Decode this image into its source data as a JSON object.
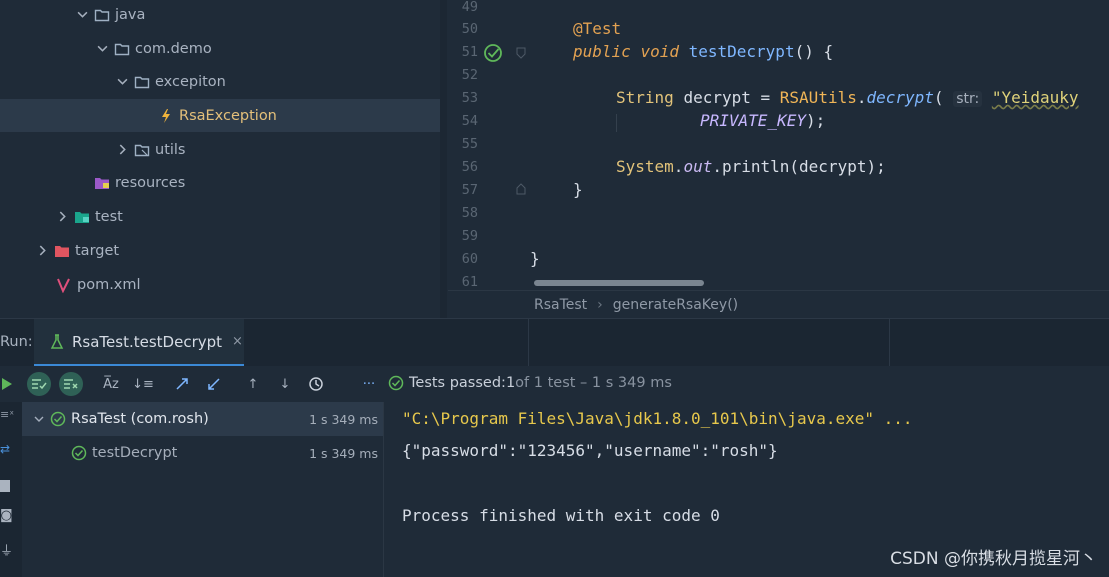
{
  "tree": [
    {
      "label": "java",
      "icon": "folder-icon",
      "expanded": true
    },
    {
      "label": "com.demo",
      "icon": "package-folder-icon",
      "expanded": true
    },
    {
      "label": "excepiton",
      "icon": "package-folder-icon",
      "expanded": true
    },
    {
      "label": "RsaException",
      "icon": "exception-class-icon"
    },
    {
      "label": "utils",
      "icon": "package-folder-icon",
      "expanded": false
    },
    {
      "label": "resources",
      "icon": "resources-folder-icon"
    },
    {
      "label": "test",
      "icon": "test-folder-icon",
      "expanded": false
    },
    {
      "label": "target",
      "icon": "excluded-folder-icon",
      "expanded": false
    },
    {
      "label": "pom.xml",
      "icon": "maven-icon"
    }
  ],
  "editor": {
    "line_numbers": [
      "49",
      "50",
      "51",
      "52",
      "53",
      "54",
      "55",
      "56",
      "57",
      "58",
      "59",
      "60",
      "61"
    ],
    "code": {
      "annotation": "@Test",
      "kw_public": "public",
      "kw_void": "void",
      "method_name": "testDecrypt",
      "sig_rest": "() {",
      "type_string": "String",
      "var_decrypt": "decrypt",
      "eq": " = ",
      "class_rsautils": "RSAUtils",
      "dot": ".",
      "method_decrypt": "decrypt",
      "paren_open": "(",
      "hint_str": "str:",
      "string_arg": "\"Yeidauky",
      "const_private_key": "PRIVATE_KEY",
      "close_stmt": ");",
      "system": "System",
      "out": "out",
      "println": ".println(decrypt);",
      "brace_close": "}",
      "class_close": "}"
    },
    "breadcrumb": [
      "RsaTest",
      "generateRsaKey()"
    ],
    "colors": {
      "keyword": "#e3a252",
      "method": "#7fb7ff",
      "string": "#e0d37a",
      "background": "#1f2b38"
    }
  },
  "run": {
    "label": "Run:",
    "tab_title": "RsaTest.testDecrypt",
    "tab_close": "×",
    "status": {
      "prefix": "Tests passed: ",
      "count": "1",
      "suffix": " of 1 test – 1 s 349 ms"
    },
    "test_tree": [
      {
        "label": "RsaTest (com.rosh)",
        "time": "1 s 349 ms"
      },
      {
        "label": "testDecrypt",
        "time": "1 s 349 ms"
      }
    ],
    "console": [
      "\"C:\\Program Files\\Java\\jdk1.8.0_101\\bin\\java.exe\" ...",
      "{\"password\":\"123456\",\"username\":\"rosh\"}",
      "",
      "Process finished with exit code 0"
    ],
    "console_path_color": "#e7c84c"
  },
  "watermark": "CSDN @你携秋月揽星河丶"
}
